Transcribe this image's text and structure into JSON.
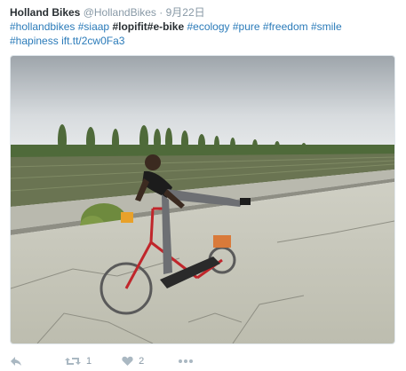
{
  "tweet": {
    "name": "Holland Bikes",
    "handle": "@HollandBikes",
    "separator": "·",
    "date": "9月22日",
    "hashtags": [
      {
        "text": "#hollandbikes",
        "bold": false
      },
      {
        "text": "#siaap",
        "bold": false
      },
      {
        "text": "#lopifit",
        "bold": true
      },
      {
        "text": "#e-bike",
        "bold": true
      },
      {
        "text": "#ecology",
        "bold": false
      },
      {
        "text": "#pure",
        "bold": false
      },
      {
        "text": "#freedom",
        "bold": false
      },
      {
        "text": "#smile",
        "bold": false
      },
      {
        "text": "#hapiness",
        "bold": false
      }
    ],
    "link": "ift.tt/2cw0Fa3"
  },
  "actions": {
    "reply": {
      "icon": "reply-icon"
    },
    "retweet": {
      "icon": "retweet-icon",
      "count": "1"
    },
    "like": {
      "icon": "heart-icon",
      "count": "2"
    },
    "more": {
      "icon": "more-icon"
    }
  },
  "colors": {
    "link": "#2b7bb9",
    "text": "#292f33",
    "muted": "#8899a6",
    "icon": "#aab8c2",
    "bike": "#c0262b"
  }
}
